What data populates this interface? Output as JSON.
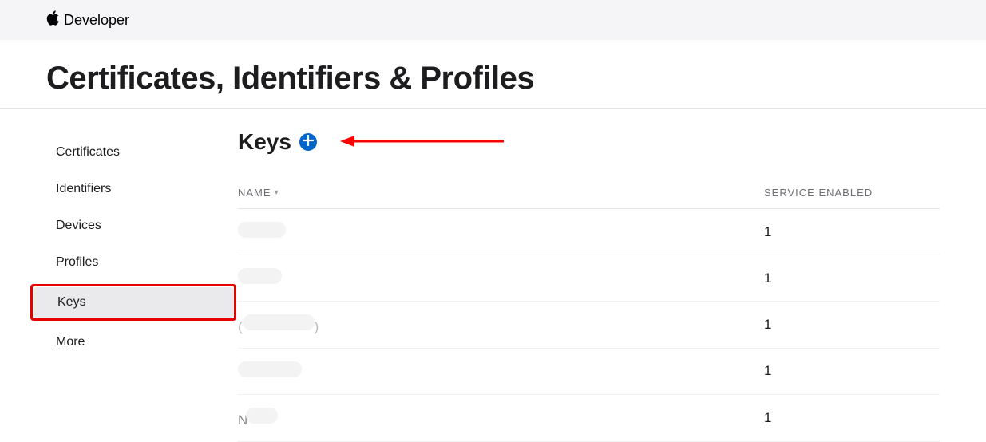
{
  "header": {
    "brand": "Developer"
  },
  "page": {
    "title": "Certificates, Identifiers & Profiles"
  },
  "sidebar": {
    "items": [
      {
        "label": "Certificates"
      },
      {
        "label": "Identifiers"
      },
      {
        "label": "Devices"
      },
      {
        "label": "Profiles"
      },
      {
        "label": "Keys"
      },
      {
        "label": "More"
      }
    ],
    "active_index": 4
  },
  "main": {
    "section_title": "Keys",
    "columns": {
      "name": "NAME",
      "service": "SERVICE ENABLED"
    },
    "rows": [
      {
        "name_redacted": true,
        "service_enabled": "1"
      },
      {
        "name_redacted": true,
        "service_enabled": "1"
      },
      {
        "name_redacted": true,
        "service_enabled": "1"
      },
      {
        "name_redacted": true,
        "service_enabled": "1"
      },
      {
        "name_redacted": true,
        "service_enabled": "1"
      }
    ]
  },
  "annotations": {
    "highlight_sidebar_keys": true,
    "arrow_to_add": true
  }
}
